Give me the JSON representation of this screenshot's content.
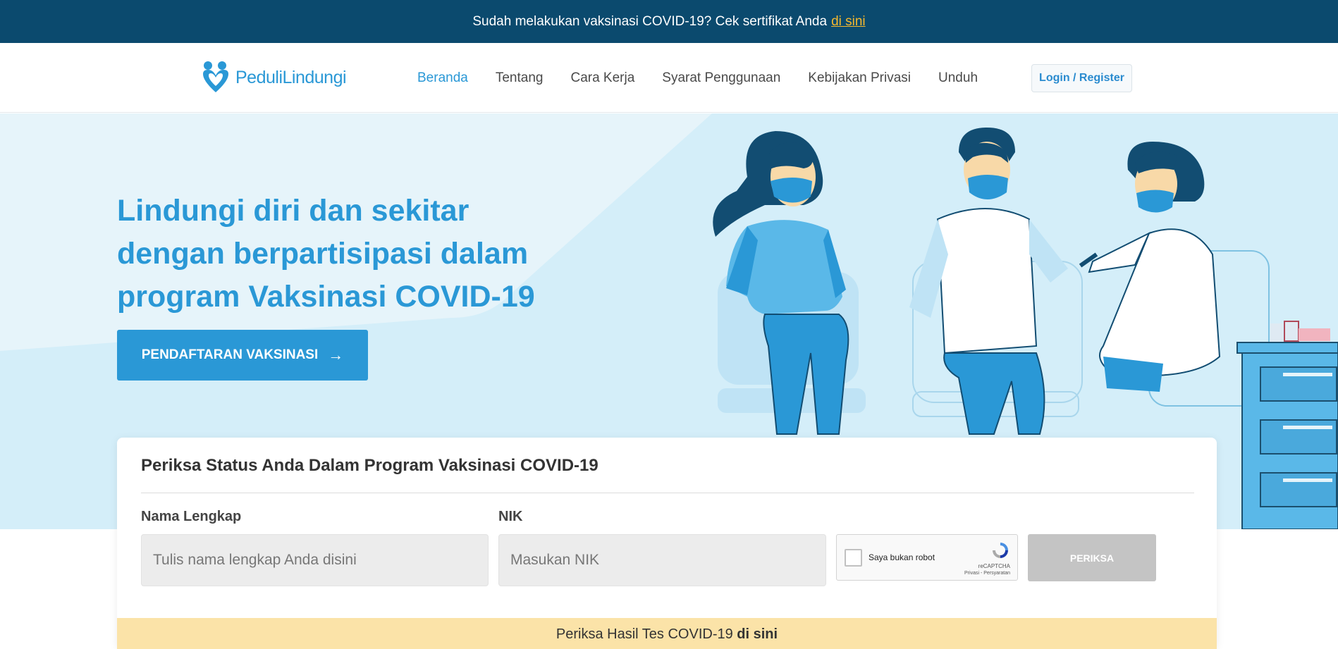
{
  "topbar": {
    "text": "Sudah melakukan vaksinasi COVID-19? Cek sertifikat Anda",
    "link": "di sini"
  },
  "brand": {
    "name": "PeduliLindungi"
  },
  "nav": {
    "items": [
      {
        "label": "Beranda"
      },
      {
        "label": "Tentang"
      },
      {
        "label": "Cara Kerja"
      },
      {
        "label": "Syarat Penggunaan"
      },
      {
        "label": "Kebijakan Privasi"
      },
      {
        "label": "Unduh"
      }
    ],
    "login_label": "Login / Register"
  },
  "hero": {
    "title": "Lindungi diri dan sekitar dengan berpartisipasi dalam program Vaksinasi COVID-19",
    "cta_label": "PENDAFTARAN VAKSINASI",
    "cta_icon": "arrow-right-icon"
  },
  "check": {
    "title": "Periksa Status Anda Dalam Program Vaksinasi COVID-19",
    "name_label": "Nama Lengkap",
    "name_placeholder": "Tulis nama lengkap Anda disini",
    "nik_label": "NIK",
    "nik_placeholder": "Masukan NIK",
    "captcha_text": "Saya bukan robot",
    "captcha_brand": "reCAPTCHA",
    "captcha_terms": "Privasi - Persyaratan",
    "button_label": "PERIKSA"
  },
  "banner": {
    "text": "Periksa Hasil Tes COVID-19",
    "link": "di sini"
  },
  "colors": {
    "brand_blue": "#2a98d6",
    "topbar_bg": "#0b4a6e",
    "hero_bg": "#d4eef9",
    "link_orange": "#f5b82e",
    "banner_bg": "#fbe3a8"
  }
}
